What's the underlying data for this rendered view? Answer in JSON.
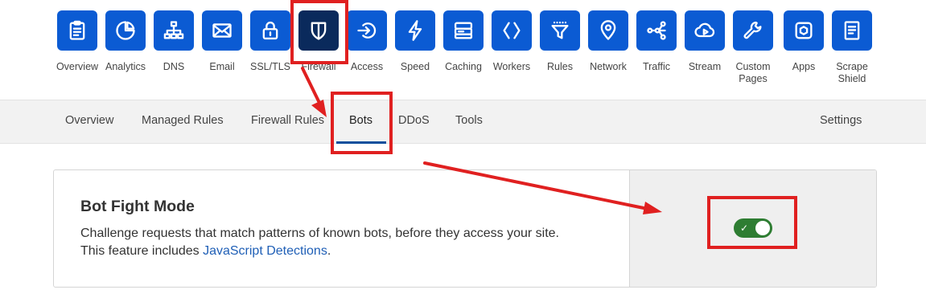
{
  "nav": {
    "items": [
      {
        "label": "Overview",
        "icon": "clipboard-icon"
      },
      {
        "label": "Analytics",
        "icon": "pie-chart-icon"
      },
      {
        "label": "DNS",
        "icon": "sitemap-icon"
      },
      {
        "label": "Email",
        "icon": "envelope-icon"
      },
      {
        "label": "SSL/TLS",
        "icon": "lock-icon"
      },
      {
        "label": "Firewall",
        "icon": "shield-icon"
      },
      {
        "label": "Access",
        "icon": "sign-in-icon"
      },
      {
        "label": "Speed",
        "icon": "lightning-icon"
      },
      {
        "label": "Caching",
        "icon": "server-icon"
      },
      {
        "label": "Workers",
        "icon": "code-chevrons-icon"
      },
      {
        "label": "Rules",
        "icon": "funnel-icon"
      },
      {
        "label": "Network",
        "icon": "location-pin-icon"
      },
      {
        "label": "Traffic",
        "icon": "share-nodes-icon"
      },
      {
        "label": "Stream",
        "icon": "cloud-play-icon"
      },
      {
        "label": "Custom Pages",
        "icon": "wrench-icon"
      },
      {
        "label": "Apps",
        "icon": "hexagon-icon"
      },
      {
        "label": "Scrape Shield",
        "icon": "document-icon"
      }
    ],
    "active": "Firewall"
  },
  "subnav": {
    "tabs": [
      "Overview",
      "Managed Rules",
      "Firewall Rules",
      "Bots",
      "DDoS",
      "Tools"
    ],
    "active": "Bots",
    "settings_label": "Settings"
  },
  "bot_fight_mode": {
    "title": "Bot Fight Mode",
    "description_line1": "Challenge requests that match patterns of known bots, before they access your site.",
    "description_prefix": "This feature includes ",
    "link_text": "JavaScript Detections",
    "description_suffix": ".",
    "toggle_on": true,
    "toggle_check_glyph": "✓"
  },
  "colors": {
    "tile_blue": "#0b5bd3",
    "tile_active": "#0a2a5c",
    "toggle_green": "#2e7d32",
    "annotation_red": "#e02020",
    "link_blue": "#1f5fb6",
    "tab_underline": "#0b4f9c"
  }
}
